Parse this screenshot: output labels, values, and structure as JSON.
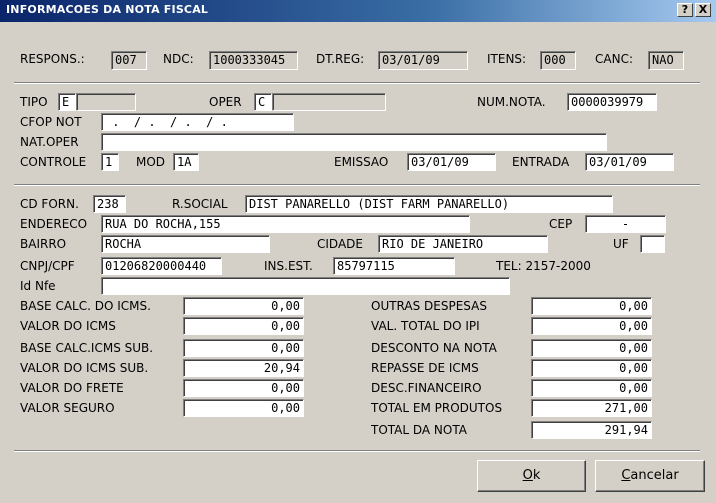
{
  "window": {
    "title": "INFORMACOES DA NOTA FISCAL",
    "help": "?",
    "close": "X"
  },
  "header": {
    "respons_label": "RESPONS.:",
    "respons": "007",
    "ndc_label": "NDC:",
    "ndc": "1000333045",
    "dtreg_label": "DT.REG:",
    "dtreg": "03/01/09",
    "itens_label": "ITENS:",
    "itens": "000",
    "canc_label": "CANC:",
    "canc": "NAO"
  },
  "nota": {
    "tipo_label": "TIPO",
    "tipo": "E",
    "tipo_desc": "",
    "oper_label": "OPER",
    "oper": "C",
    "oper_desc": "",
    "numnota_label": "NUM.NOTA.",
    "numnota": "0000039979",
    "cfop_label": "CFOP NOT",
    "cfop": " .  / .  / .  / .",
    "natoper_label": "NAT.OPER",
    "natoper": "",
    "controle_label": "CONTROLE",
    "controle": "1",
    "mod_label": "MOD",
    "mod": "1A",
    "emissao_label": "EMISSAO",
    "emissao": "03/01/09",
    "entrada_label": "ENTRADA",
    "entrada": "03/01/09"
  },
  "fornecedor": {
    "cdforn_label": "CD FORN.",
    "cdforn": "238",
    "rsocial_label": "R.SOCIAL",
    "rsocial": "DIST PANARELLO (DIST FARM PANARELLO)",
    "endereco_label": "ENDERECO",
    "endereco": "RUA DO ROCHA,155",
    "cep_label": "CEP",
    "cep": "-",
    "bairro_label": "BAIRRO",
    "bairro": "ROCHA",
    "cidade_label": "CIDADE",
    "cidade": "RIO DE JANEIRO",
    "uf_label": "UF",
    "uf": "",
    "cnpj_label": "CNPJ/CPF",
    "cnpj": "01206820000440",
    "insest_label": "INS.EST.",
    "insest": "85797115",
    "tel": "TEL: 2157-2000",
    "idnfe_label": "Id Nfe",
    "idnfe": ""
  },
  "valores": {
    "base_icms_label": "BASE CALC. DO ICMS.",
    "base_icms": "0,00",
    "valor_icms_label": "VALOR DO ICMS",
    "valor_icms": "0,00",
    "base_icms_sub_label": "BASE CALC.ICMS SUB.",
    "base_icms_sub": "0,00",
    "valor_icms_sub_label": "VALOR DO ICMS SUB.",
    "valor_icms_sub": "20,94",
    "valor_frete_label": "VALOR DO FRETE",
    "valor_frete": "0,00",
    "valor_seguro_label": "VALOR SEGURO",
    "valor_seguro": "0,00",
    "outras_despesas_label": "OUTRAS DESPESAS",
    "outras_despesas": "0,00",
    "val_total_ipi_label": "VAL. TOTAL DO IPI",
    "val_total_ipi": "0,00",
    "desconto_nota_label": "DESCONTO NA NOTA",
    "desconto_nota": "0,00",
    "repasse_icms_label": "REPASSE DE ICMS",
    "repasse_icms": "0,00",
    "desc_financeiro_label": "DESC.FINANCEIRO",
    "desc_financeiro": "0,00",
    "total_produtos_label": "TOTAL EM PRODUTOS",
    "total_produtos": "271,00",
    "total_nota_label": "TOTAL DA NOTA",
    "total_nota": "291,94"
  },
  "buttons": {
    "ok_pre": "",
    "ok_u": "O",
    "ok_post": "k",
    "cancel_pre": "",
    "cancel_u": "C",
    "cancel_post": "ancelar"
  }
}
